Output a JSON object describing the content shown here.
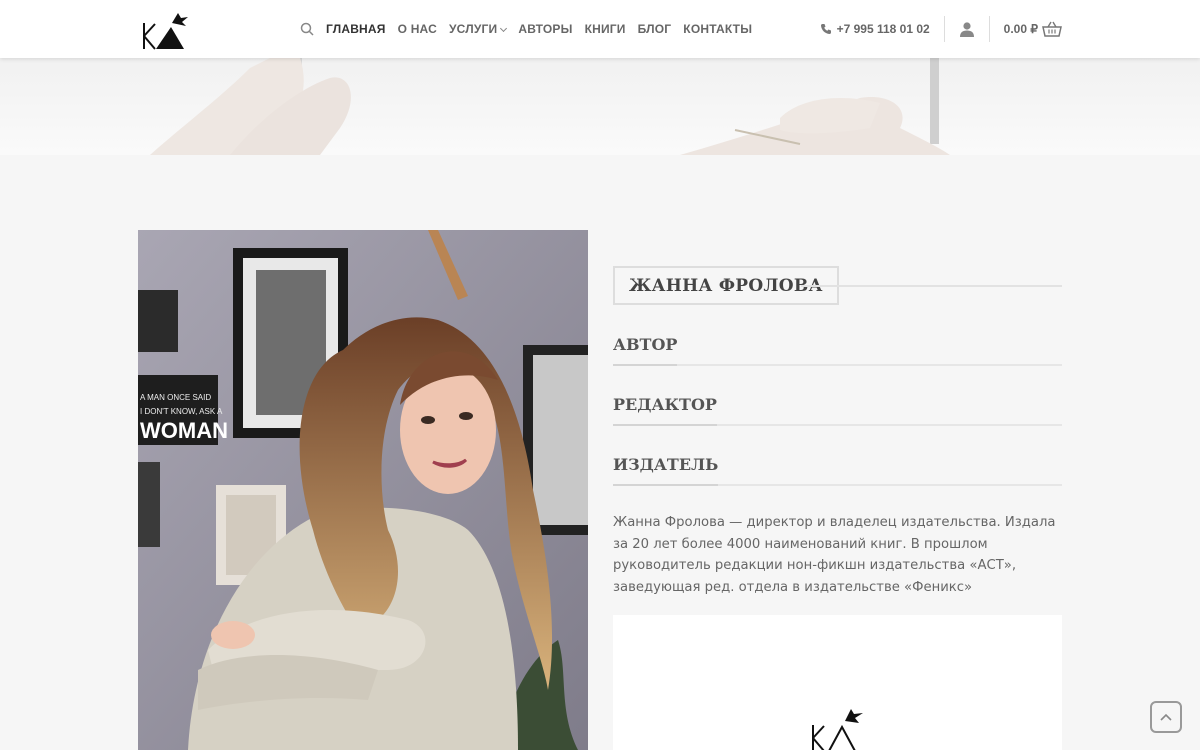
{
  "header": {
    "nav": [
      "ГЛАВНАЯ",
      "О НАС",
      "УСЛУГИ",
      "АВТОРЫ",
      "КНИГИ",
      "БЛОГ",
      "КОНТАКТЫ"
    ],
    "phone": "+7 995 118 01 02",
    "cart_total": "0.00 ₽"
  },
  "profile": {
    "name": "ЖАННА ФРОЛОВА",
    "roles": [
      "АВТОР",
      "РЕДАКТОР",
      "ИЗДАТЕЛЬ"
    ],
    "description": "Жанна Фролова — директор и владелец издательства. Издала за 20 лет более 4000 наименований книг. В прошлом руководитель редакции нон-фикшн издательства «АСТ», заведующая ред. отдела в издательстве «Феникс»",
    "photo_poster_text": [
      "A MAN ONCE SAID",
      "I DON'T KNOW, ASK A",
      "WOMAN"
    ]
  },
  "icons": {
    "search": "search-icon",
    "phone": "phone-icon",
    "user": "user-icon",
    "cart": "basket-icon",
    "back_to_top": "chevron-up-icon"
  },
  "colors": {
    "background": "#f6f6f6",
    "header": "#ffffff",
    "text": "#444444"
  }
}
